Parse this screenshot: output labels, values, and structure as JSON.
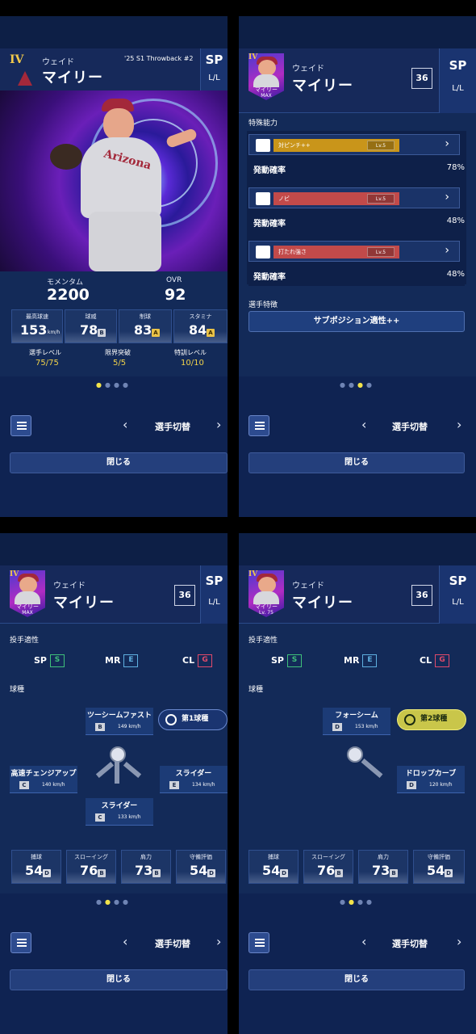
{
  "player": {
    "first_name": "ウェイド",
    "last_name": "マイリー",
    "series": "'25 S1 Throwback #2",
    "rank": "IV",
    "position": "SP",
    "hand": "L/L",
    "number": "36",
    "portrait_tag_max": "マイリー",
    "portrait_sub_max": "MAX",
    "portrait_sub_lv": "Lv. 75"
  },
  "panel1": {
    "momentum_label": "モメンタム",
    "momentum_value": "2200",
    "ovr_label": "OVR",
    "ovr_value": "92",
    "stats": [
      {
        "label": "最高球速",
        "value": "153",
        "unit": "km/h",
        "grade": ""
      },
      {
        "label": "球威",
        "value": "78",
        "unit": "",
        "grade": "B"
      },
      {
        "label": "制球",
        "value": "83",
        "unit": "",
        "grade": "A"
      },
      {
        "label": "スタミナ",
        "value": "84",
        "unit": "",
        "grade": "A"
      }
    ],
    "levels": [
      {
        "label": "選手レベル",
        "value": "75/75"
      },
      {
        "label": "限界突破",
        "value": "5/5"
      },
      {
        "label": "特訓レベル",
        "value": "10/10"
      }
    ]
  },
  "panel2": {
    "special_title": "特殊能力",
    "abilities": [
      {
        "name": "対ピンチ++",
        "level": "Lv.5",
        "prob_label": "発動確率",
        "prob": "78%",
        "color": "#c9951a"
      },
      {
        "name": "ノビ",
        "level": "Lv.5",
        "prob_label": "発動確率",
        "prob": "48%",
        "color": "#c24a4a"
      },
      {
        "name": "打たれ強さ",
        "level": "Lv.5",
        "prob_label": "発動確率",
        "prob": "48%",
        "color": "#c24a4a"
      }
    ],
    "trait_title": "選手特徴",
    "trait_button": "サブポジション適性++"
  },
  "pitching": {
    "aptitude_title": "投手適性",
    "aptitudes": [
      {
        "pos": "SP",
        "grade": "S",
        "color": "#3fc07a"
      },
      {
        "pos": "MR",
        "grade": "E",
        "color": "#5fb0e0"
      },
      {
        "pos": "CL",
        "grade": "G",
        "color": "#e04a6a"
      }
    ],
    "pitch_title": "球種",
    "set1": {
      "main_label": "第1球種",
      "pitches": [
        {
          "name": "ツーシームファスト",
          "grade": "B",
          "speed": "149 km/h"
        },
        {
          "name": "高速チェンジアップ",
          "grade": "C",
          "speed": "140 km/h"
        },
        {
          "name": "スライダー",
          "grade": "E",
          "speed": "134 km/h"
        },
        {
          "name": "スライダー",
          "grade": "C",
          "speed": "133 km/h"
        }
      ]
    },
    "set2": {
      "main_label": "第2球種",
      "pitches": [
        {
          "name": "フォーシーム",
          "grade": "D",
          "speed": "153 km/h"
        },
        {
          "name": "ドロップカーブ",
          "grade": "D",
          "speed": "120 km/h"
        }
      ]
    },
    "fielding": [
      {
        "label": "捕球",
        "value": "54",
        "grade": "D"
      },
      {
        "label": "スローイング",
        "value": "76",
        "grade": "B"
      },
      {
        "label": "肩力",
        "value": "73",
        "grade": "B"
      },
      {
        "label": "守備評価",
        "value": "54",
        "grade": "D"
      }
    ]
  },
  "nav": {
    "switch_label": "選手切替",
    "close_label": "閉じる",
    "prev": "‹",
    "next": "›"
  }
}
